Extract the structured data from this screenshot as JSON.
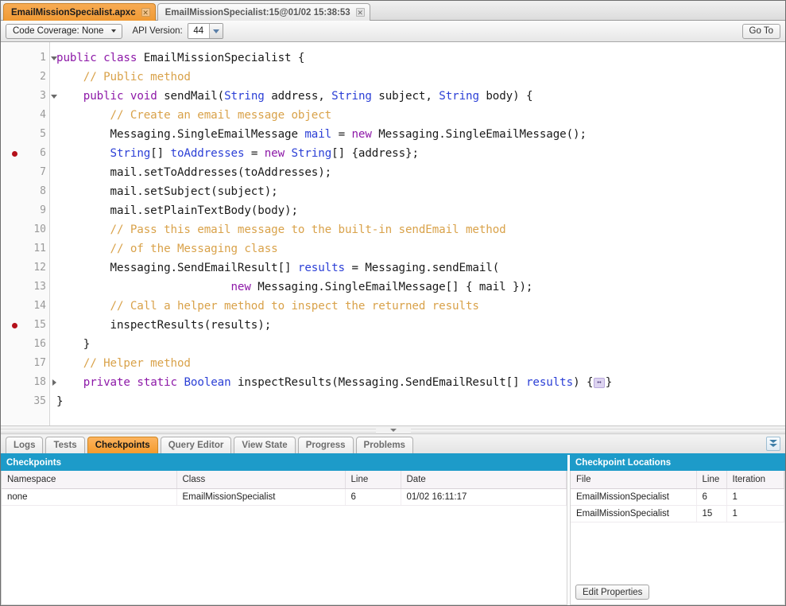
{
  "file_tabs": [
    {
      "label": "EmailMissionSpecialist.apxc",
      "active": true,
      "close_icon": "✕"
    },
    {
      "label": "EmailMissionSpecialist:15@01/02 15:38:53",
      "active": false,
      "close_icon": "✕"
    }
  ],
  "toolbar": {
    "code_coverage_label": "Code Coverage: None",
    "api_version_label": "API Version:",
    "api_version_value": "44",
    "go_to_label": "Go To"
  },
  "editor": {
    "lines": [
      {
        "num": "1",
        "fold": "down",
        "breakpoint": false,
        "tokens": [
          {
            "t": "kw",
            "s": "public"
          },
          {
            "t": "pln",
            "s": " "
          },
          {
            "t": "kw",
            "s": "class"
          },
          {
            "t": "pln",
            "s": " EmailMissionSpecialist {"
          }
        ]
      },
      {
        "num": "2",
        "fold": "",
        "breakpoint": false,
        "tokens": [
          {
            "t": "cmt",
            "s": "    // Public method"
          }
        ]
      },
      {
        "num": "3",
        "fold": "down",
        "breakpoint": false,
        "tokens": [
          {
            "t": "pln",
            "s": "    "
          },
          {
            "t": "kw",
            "s": "public"
          },
          {
            "t": "pln",
            "s": " "
          },
          {
            "t": "kw",
            "s": "void"
          },
          {
            "t": "pln",
            "s": " sendMail("
          },
          {
            "t": "typ",
            "s": "String"
          },
          {
            "t": "pln",
            "s": " address, "
          },
          {
            "t": "typ",
            "s": "String"
          },
          {
            "t": "pln",
            "s": " subject, "
          },
          {
            "t": "typ",
            "s": "String"
          },
          {
            "t": "pln",
            "s": " body) {"
          }
        ]
      },
      {
        "num": "4",
        "fold": "",
        "breakpoint": false,
        "tokens": [
          {
            "t": "cmt",
            "s": "        // Create an email message object"
          }
        ]
      },
      {
        "num": "5",
        "fold": "",
        "breakpoint": false,
        "tokens": [
          {
            "t": "pln",
            "s": "        Messaging.SingleEmailMessage "
          },
          {
            "t": "var",
            "s": "mail"
          },
          {
            "t": "pln",
            "s": " = "
          },
          {
            "t": "kw",
            "s": "new"
          },
          {
            "t": "pln",
            "s": " Messaging.SingleEmailMessage();"
          }
        ]
      },
      {
        "num": "6",
        "fold": "",
        "breakpoint": true,
        "tokens": [
          {
            "t": "pln",
            "s": "        "
          },
          {
            "t": "typ",
            "s": "String"
          },
          {
            "t": "pln",
            "s": "[] "
          },
          {
            "t": "var",
            "s": "toAddresses"
          },
          {
            "t": "pln",
            "s": " = "
          },
          {
            "t": "kw",
            "s": "new"
          },
          {
            "t": "pln",
            "s": " "
          },
          {
            "t": "typ",
            "s": "String"
          },
          {
            "t": "pln",
            "s": "[] {address};"
          }
        ]
      },
      {
        "num": "7",
        "fold": "",
        "breakpoint": false,
        "tokens": [
          {
            "t": "pln",
            "s": "        mail.setToAddresses(toAddresses);"
          }
        ]
      },
      {
        "num": "8",
        "fold": "",
        "breakpoint": false,
        "tokens": [
          {
            "t": "pln",
            "s": "        mail.setSubject(subject);"
          }
        ]
      },
      {
        "num": "9",
        "fold": "",
        "breakpoint": false,
        "tokens": [
          {
            "t": "pln",
            "s": "        mail.setPlainTextBody(body);"
          }
        ]
      },
      {
        "num": "10",
        "fold": "",
        "breakpoint": false,
        "tokens": [
          {
            "t": "cmt",
            "s": "        // Pass this email message to the built-in sendEmail method"
          }
        ]
      },
      {
        "num": "11",
        "fold": "",
        "breakpoint": false,
        "tokens": [
          {
            "t": "cmt",
            "s": "        // of the Messaging class"
          }
        ]
      },
      {
        "num": "12",
        "fold": "",
        "breakpoint": false,
        "tokens": [
          {
            "t": "pln",
            "s": "        Messaging.SendEmailResult[] "
          },
          {
            "t": "var",
            "s": "results"
          },
          {
            "t": "pln",
            "s": " = Messaging.sendEmail("
          }
        ]
      },
      {
        "num": "13",
        "fold": "",
        "breakpoint": false,
        "tokens": [
          {
            "t": "pln",
            "s": "                          "
          },
          {
            "t": "kw",
            "s": "new"
          },
          {
            "t": "pln",
            "s": " Messaging.SingleEmailMessage[] { mail });"
          }
        ]
      },
      {
        "num": "14",
        "fold": "",
        "breakpoint": false,
        "tokens": [
          {
            "t": "cmt",
            "s": "        // Call a helper method to inspect the returned results"
          }
        ]
      },
      {
        "num": "15",
        "fold": "",
        "breakpoint": true,
        "tokens": [
          {
            "t": "pln",
            "s": "        inspectResults(results);"
          }
        ]
      },
      {
        "num": "16",
        "fold": "",
        "breakpoint": false,
        "tokens": [
          {
            "t": "pln",
            "s": "    }"
          }
        ]
      },
      {
        "num": "17",
        "fold": "",
        "breakpoint": false,
        "tokens": [
          {
            "t": "cmt",
            "s": "    // Helper method"
          }
        ]
      },
      {
        "num": "18",
        "fold": "right",
        "breakpoint": false,
        "tokens": [
          {
            "t": "pln",
            "s": "    "
          },
          {
            "t": "kw",
            "s": "private"
          },
          {
            "t": "pln",
            "s": " "
          },
          {
            "t": "kw",
            "s": "static"
          },
          {
            "t": "pln",
            "s": " "
          },
          {
            "t": "typ",
            "s": "Boolean"
          },
          {
            "t": "pln",
            "s": " inspectResults(Messaging.SendEmailResult[] "
          },
          {
            "t": "var",
            "s": "results"
          },
          {
            "t": "pln",
            "s": ") {"
          },
          {
            "t": "foldbox",
            "s": "↔"
          },
          {
            "t": "pln",
            "s": "}"
          }
        ]
      },
      {
        "num": "35",
        "fold": "",
        "breakpoint": false,
        "tokens": [
          {
            "t": "pln",
            "s": "}"
          }
        ]
      }
    ]
  },
  "bottom_tabs": [
    {
      "label": "Logs",
      "active": false
    },
    {
      "label": "Tests",
      "active": false
    },
    {
      "label": "Checkpoints",
      "active": true
    },
    {
      "label": "Query Editor",
      "active": false
    },
    {
      "label": "View State",
      "active": false
    },
    {
      "label": "Progress",
      "active": false
    },
    {
      "label": "Problems",
      "active": false
    }
  ],
  "checkpoints_panel": {
    "title": "Checkpoints",
    "columns": [
      "Namespace",
      "Class",
      "Line",
      "Date"
    ],
    "rows": [
      [
        "none",
        "EmailMissionSpecialist",
        "6",
        "01/02 16:11:17"
      ]
    ]
  },
  "checkpoint_locations_panel": {
    "title": "Checkpoint Locations",
    "columns": [
      "File",
      "Line",
      "Iteration"
    ],
    "rows": [
      [
        "EmailMissionSpecialist",
        "6",
        "1"
      ],
      [
        "EmailMissionSpecialist",
        "15",
        "1"
      ]
    ],
    "edit_properties_label": "Edit Properties"
  },
  "colors": {
    "tab_active": "#f09a34",
    "panel_header": "#1d9bc9",
    "keyword": "#8d19a8",
    "type": "#2b3fd6",
    "comment": "#d9a24a",
    "breakpoint": "#b4101a"
  }
}
